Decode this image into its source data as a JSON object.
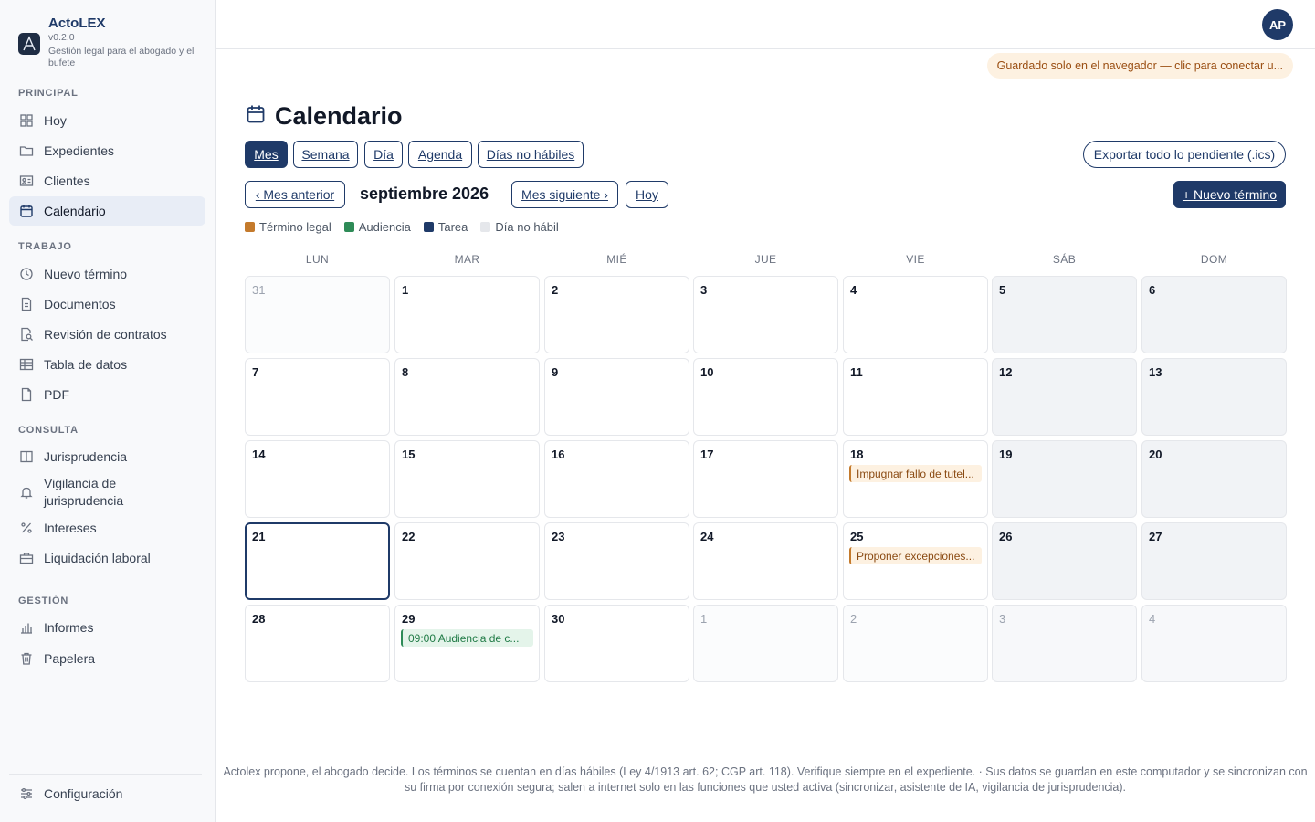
{
  "brand": {
    "name": "ActoLEX",
    "version": "v0.2.0",
    "tagline": "Gestión legal para el abogado y el bufete"
  },
  "sidebar": {
    "sections": [
      {
        "title": "PRINCIPAL",
        "items": [
          {
            "label": "Hoy",
            "icon": "grid-icon"
          },
          {
            "label": "Expedientes",
            "icon": "folder-icon"
          },
          {
            "label": "Clientes",
            "icon": "id-card-icon"
          },
          {
            "label": "Calendario",
            "icon": "calendar-icon",
            "active": true
          }
        ]
      },
      {
        "title": "TRABAJO",
        "items": [
          {
            "label": "Nuevo término",
            "icon": "clock-icon"
          },
          {
            "label": "Documentos",
            "icon": "document-icon"
          },
          {
            "label": "Revisión de contratos",
            "icon": "document-search-icon"
          },
          {
            "label": "Tabla de datos",
            "icon": "table-icon"
          },
          {
            "label": "PDF",
            "icon": "file-icon"
          }
        ]
      },
      {
        "title": "CONSULTA",
        "items": [
          {
            "label": "Jurisprudencia",
            "icon": "book-icon"
          },
          {
            "label": "Vigilancia de jurisprudencia",
            "icon": "bell-icon"
          },
          {
            "label": "Intereses",
            "icon": "percent-icon"
          },
          {
            "label": "Liquidación laboral",
            "icon": "briefcase-icon"
          }
        ]
      },
      {
        "title": "GESTIÓN",
        "items": [
          {
            "label": "Informes",
            "icon": "bar-chart-icon"
          },
          {
            "label": "Papelera",
            "icon": "trash-icon"
          }
        ]
      }
    ],
    "settings_label": "Configuración"
  },
  "header": {
    "avatar_initials": "AP",
    "save_banner": "Guardado solo en el navegador — clic para conectar u..."
  },
  "page": {
    "title": "Calendario",
    "view_tabs": [
      "Mes",
      "Semana",
      "Día",
      "Agenda",
      "Días no hábiles"
    ],
    "active_view": "Mes",
    "export_label": "Exportar todo lo pendiente (.ics)",
    "prev_label": "‹ Mes anterior",
    "month_label": "septiembre 2026",
    "next_label": "Mes siguiente ›",
    "today_label": "Hoy",
    "new_term_label": "+ Nuevo término"
  },
  "legend": [
    {
      "label": "Término legal",
      "color": "#c47a2c"
    },
    {
      "label": "Audiencia",
      "color": "#2e8b57"
    },
    {
      "label": "Tarea",
      "color": "#1f3a68"
    },
    {
      "label": "Día no hábil",
      "color": "#e5e7eb"
    }
  ],
  "calendar": {
    "weekdays": [
      "LUN",
      "MAR",
      "MIÉ",
      "JUE",
      "VIE",
      "SÁB",
      "DOM"
    ],
    "today": 21,
    "weeks": [
      [
        {
          "d": "31",
          "other": true
        },
        {
          "d": "1"
        },
        {
          "d": "2"
        },
        {
          "d": "3"
        },
        {
          "d": "4"
        },
        {
          "d": "5"
        },
        {
          "d": "6"
        }
      ],
      [
        {
          "d": "7"
        },
        {
          "d": "8"
        },
        {
          "d": "9"
        },
        {
          "d": "10"
        },
        {
          "d": "11"
        },
        {
          "d": "12"
        },
        {
          "d": "13"
        }
      ],
      [
        {
          "d": "14"
        },
        {
          "d": "15"
        },
        {
          "d": "16"
        },
        {
          "d": "17"
        },
        {
          "d": "18",
          "event": {
            "text": "Impugnar fallo de tutel...",
            "kind": "legal"
          }
        },
        {
          "d": "19"
        },
        {
          "d": "20"
        }
      ],
      [
        {
          "d": "21",
          "today": true
        },
        {
          "d": "22"
        },
        {
          "d": "23"
        },
        {
          "d": "24"
        },
        {
          "d": "25",
          "event": {
            "text": "Proponer excepciones...",
            "kind": "legal"
          }
        },
        {
          "d": "26"
        },
        {
          "d": "27"
        }
      ],
      [
        {
          "d": "28"
        },
        {
          "d": "29",
          "event": {
            "text": "09:00 Audiencia de c...",
            "kind": "hearing"
          }
        },
        {
          "d": "30"
        },
        {
          "d": "1",
          "other": true
        },
        {
          "d": "2",
          "other": true
        },
        {
          "d": "3",
          "other": true
        },
        {
          "d": "4",
          "other": true
        }
      ]
    ]
  },
  "footer": {
    "line1": "Actolex propone, el abogado decide. Los términos se cuentan en días hábiles (Ley 4/1913 art. 62; CGP art. 118). Verifique siempre en el expediente. · Sus datos se guardan en este computador y se sincronizan con",
    "line2": "su firma por conexión segura; salen a internet solo en las funciones que usted activa (sincronizar, asistente de IA, vigilancia de jurisprudencia)."
  }
}
